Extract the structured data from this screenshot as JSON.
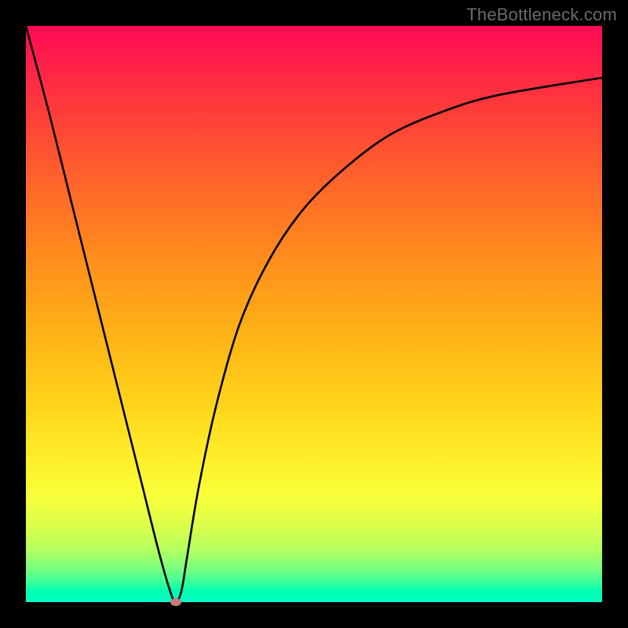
{
  "watermark": "TheBottleneck.com",
  "colors": {
    "background": "#000000",
    "curve": "#000000",
    "dot": "#cc7a7d"
  },
  "chart_data": {
    "type": "line",
    "title": "",
    "xlabel": "",
    "ylabel": "",
    "xlim": [
      0,
      100
    ],
    "ylim": [
      0,
      100
    ],
    "series": [
      {
        "name": "bottleneck-curve",
        "x": [
          0,
          4,
          8,
          12,
          16,
          20,
          23,
          25,
          26,
          27,
          28,
          30,
          33,
          37,
          42,
          48,
          55,
          63,
          72,
          82,
          100
        ],
        "y": [
          100,
          85,
          69,
          53,
          37,
          21,
          9,
          2,
          0,
          2,
          8,
          20,
          34,
          48,
          59,
          68,
          75,
          81,
          85,
          88,
          91
        ]
      }
    ],
    "annotations": [
      {
        "name": "minimum-point",
        "x": 26,
        "y": 0
      }
    ]
  }
}
